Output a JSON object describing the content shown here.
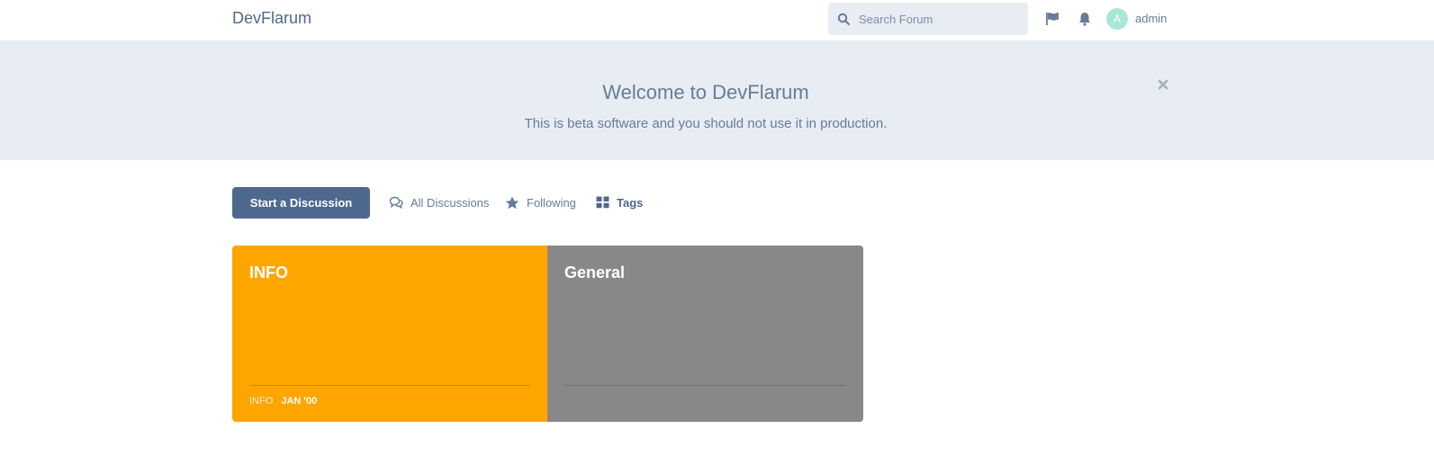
{
  "header": {
    "brand": "DevFlarum",
    "search_placeholder": "Search Forum",
    "username": "admin",
    "avatar_initial": "A",
    "icons": {
      "search": "search-icon",
      "flag": "flag-icon",
      "bell": "bell-icon"
    }
  },
  "hero": {
    "title": "Welcome to DevFlarum",
    "subtitle": "This is beta software and you should not use it in production.",
    "close_icon": "close-icon"
  },
  "nav": {
    "start_label": "Start a Discussion",
    "items": [
      {
        "label": "All Discussions",
        "icon": "comments-icon",
        "active": false
      },
      {
        "label": "Following",
        "icon": "star-icon",
        "active": false
      },
      {
        "label": "Tags",
        "icon": "th-large-icon",
        "active": true
      }
    ]
  },
  "tags": [
    {
      "name": "INFO",
      "color": "#ffa500",
      "last_discussion": "INFO",
      "last_date": "JAN '00"
    },
    {
      "name": "General",
      "color": "#888888",
      "last_discussion": "",
      "last_date": ""
    }
  ],
  "colors": {
    "primary": "#4d698e",
    "hero_bg": "#e8ecf3",
    "text": "#667c99",
    "avatar": "#a8e6d8"
  }
}
